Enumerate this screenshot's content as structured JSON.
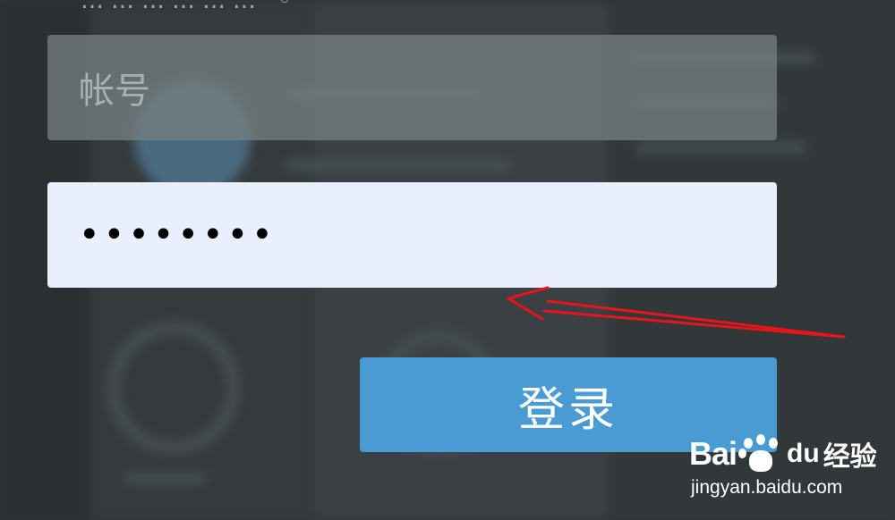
{
  "top_partial_text": "……………… ◦",
  "login_form": {
    "account_placeholder": "帐号",
    "password_masked": "••••••••",
    "login_label": "登录"
  },
  "annotation": {
    "arrow_color": "#e8141b"
  },
  "watermark": {
    "brand_bai": "Bai",
    "paw_icon": "baidu-paw-icon",
    "brand_du": "du",
    "brand_jingyan": "经验",
    "url": "jingyan.baidu.com"
  },
  "colors": {
    "button": "#4a9bd4",
    "password_field_bg": "#e9effc",
    "account_field_bg": "#7a8285"
  }
}
